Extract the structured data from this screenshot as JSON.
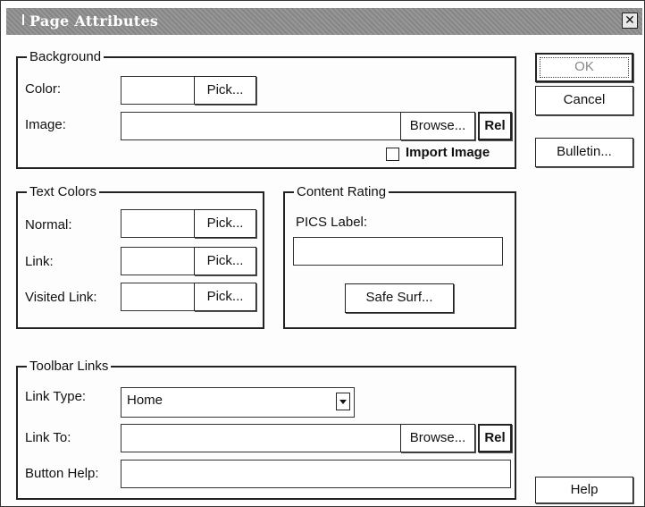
{
  "window": {
    "title": "Page Attributes",
    "close_glyph": "✕"
  },
  "background_group": {
    "legend": "Background",
    "color_label": "Color:",
    "color_value": "",
    "color_pick": "Pick...",
    "image_label": "Image:",
    "image_value": "",
    "image_browse": "Browse...",
    "image_rel": "Rel",
    "import_label": "Import Image"
  },
  "text_colors": {
    "legend": "Text Colors",
    "normal_label": "Normal:",
    "link_label": "Link:",
    "visited_label": "Visited Link:",
    "pick": "Pick..."
  },
  "content_rating": {
    "legend": "Content Rating",
    "pics_label": "PICS Label:",
    "pics_value": "",
    "safe_surf": "Safe Surf..."
  },
  "toolbar_links": {
    "legend": "Toolbar Links",
    "link_type_label": "Link Type:",
    "link_type_value": "Home",
    "link_to_label": "Link To:",
    "link_to_value": "",
    "browse": "Browse...",
    "rel": "Rel",
    "button_help_label": "Button Help:",
    "button_help_value": ""
  },
  "buttons": {
    "ok": "OK",
    "cancel": "Cancel",
    "bulletin": "Bulletin...",
    "help": "Help"
  }
}
